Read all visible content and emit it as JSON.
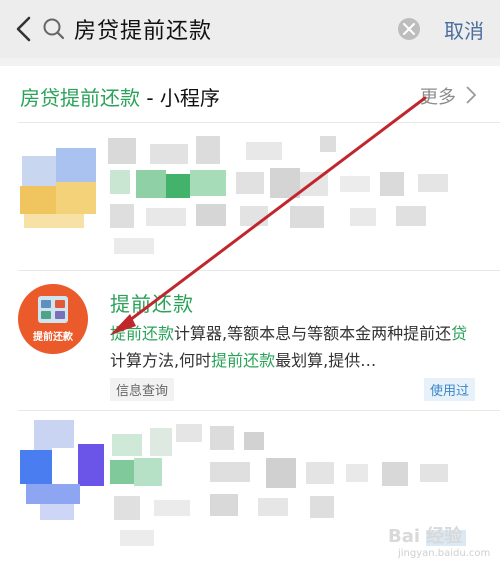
{
  "search": {
    "query": "房贷提前还款",
    "cancel_label": "取消"
  },
  "section": {
    "title_highlight": "房贷提前还款",
    "title_suffix": " - 小程序",
    "more_label": "更多"
  },
  "result": {
    "icon_label": "提前还款",
    "title": "提前还款",
    "desc_hl1": "提前还款",
    "desc_t1": "计算器,等额本息与等额本金两种提前还",
    "desc_hl2": "贷",
    "desc_t2": "计算方法,何时",
    "desc_hl3": "提前还款",
    "desc_t3": "最划算,提供…",
    "tag": "信息查询",
    "used_badge": "使用过"
  },
  "watermark": {
    "brand": "Bai 经验",
    "sub": "jingyan.baidu.com"
  },
  "colors": {
    "accent_green": "#2aa359",
    "link_blue": "#4a6e9e",
    "annotation_red": "#c0272d",
    "icon_orange": "#ea5a2b"
  }
}
